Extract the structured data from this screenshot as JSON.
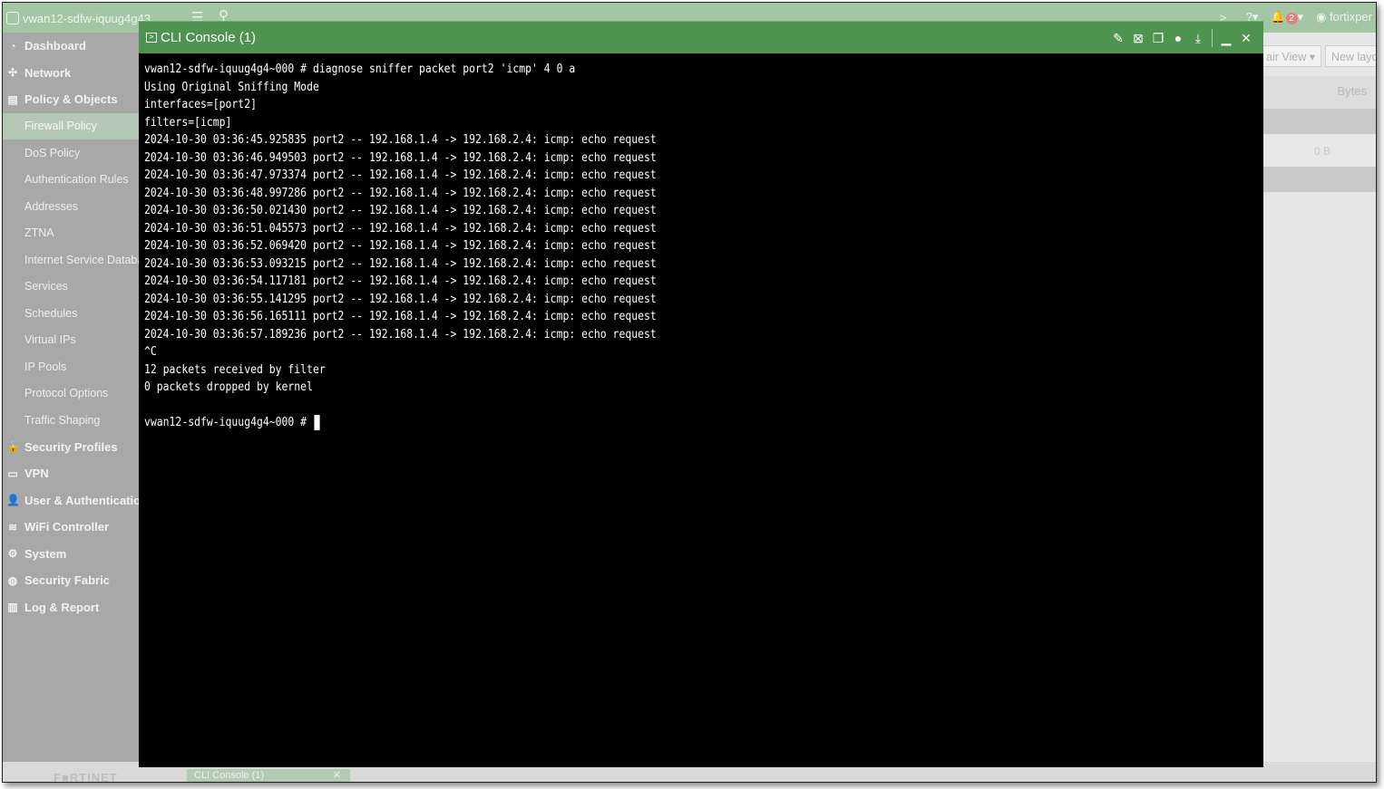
{
  "topbar": {
    "device_name": "vwan12-sdfw-iquug4g43...",
    "alert_count": "2",
    "user": "fortixper"
  },
  "sidebar": {
    "items": [
      {
        "label": "Dashboard",
        "icon": "dashboard-icon",
        "glyph": "◔",
        "type": "section"
      },
      {
        "label": "Network",
        "icon": "network-icon",
        "glyph": "✣",
        "type": "section"
      },
      {
        "label": "Policy & Objects",
        "icon": "policy-icon",
        "glyph": "▤",
        "type": "section open"
      },
      {
        "label": "Firewall Policy",
        "type": "sub active"
      },
      {
        "label": "DoS Policy",
        "type": "sub"
      },
      {
        "label": "Authentication Rules",
        "type": "sub"
      },
      {
        "label": "Addresses",
        "type": "sub"
      },
      {
        "label": "ZTNA",
        "type": "sub"
      },
      {
        "label": "Internet Service Database",
        "type": "sub"
      },
      {
        "label": "Services",
        "type": "sub"
      },
      {
        "label": "Schedules",
        "type": "sub"
      },
      {
        "label": "Virtual IPs",
        "type": "sub"
      },
      {
        "label": "IP Pools",
        "type": "sub"
      },
      {
        "label": "Protocol Options",
        "type": "sub"
      },
      {
        "label": "Traffic Shaping",
        "type": "sub"
      },
      {
        "label": "Security Profiles",
        "icon": "lock-icon",
        "glyph": "🔒",
        "type": "section"
      },
      {
        "label": "VPN",
        "icon": "vpn-icon",
        "glyph": "▭",
        "type": "section"
      },
      {
        "label": "User & Authentication",
        "icon": "user-icon",
        "glyph": "👤",
        "type": "section"
      },
      {
        "label": "WiFi Controller",
        "icon": "wifi-icon",
        "glyph": "≋",
        "type": "section"
      },
      {
        "label": "System",
        "icon": "gear-icon",
        "glyph": "⚙",
        "type": "section"
      },
      {
        "label": "Security Fabric",
        "icon": "fabric-icon",
        "glyph": "◍",
        "type": "section"
      },
      {
        "label": "Log & Report",
        "icon": "chart-icon",
        "glyph": "▥",
        "type": "section"
      }
    ]
  },
  "background": {
    "pair_view_label": "air View ▾",
    "new_layout_label": "New layo",
    "bytes_header": "Bytes",
    "bytes_value": "0 B"
  },
  "bottom": {
    "brand": "F■RTINET",
    "taskbar_tab": "CLI Console (1)"
  },
  "console": {
    "title": "CLI Console (1)",
    "lines": [
      "vwan12-sdfw-iquug4g4~000 # diagnose sniffer packet port2 'icmp' 4 0 a",
      "Using Original Sniffing Mode",
      "interfaces=[port2]",
      "filters=[icmp]",
      "2024-10-30 03:36:45.925835 port2 -- 192.168.1.4 -> 192.168.2.4: icmp: echo request",
      "2024-10-30 03:36:46.949503 port2 -- 192.168.1.4 -> 192.168.2.4: icmp: echo request",
      "2024-10-30 03:36:47.973374 port2 -- 192.168.1.4 -> 192.168.2.4: icmp: echo request",
      "2024-10-30 03:36:48.997286 port2 -- 192.168.1.4 -> 192.168.2.4: icmp: echo request",
      "2024-10-30 03:36:50.021430 port2 -- 192.168.1.4 -> 192.168.2.4: icmp: echo request",
      "2024-10-30 03:36:51.045573 port2 -- 192.168.1.4 -> 192.168.2.4: icmp: echo request",
      "2024-10-30 03:36:52.069420 port2 -- 192.168.1.4 -> 192.168.2.4: icmp: echo request",
      "2024-10-30 03:36:53.093215 port2 -- 192.168.1.4 -> 192.168.2.4: icmp: echo request",
      "2024-10-30 03:36:54.117181 port2 -- 192.168.1.4 -> 192.168.2.4: icmp: echo request",
      "2024-10-30 03:36:55.141295 port2 -- 192.168.1.4 -> 192.168.2.4: icmp: echo request",
      "2024-10-30 03:36:56.165111 port2 -- 192.168.1.4 -> 192.168.2.4: icmp: echo request",
      "2024-10-30 03:36:57.189236 port2 -- 192.168.1.4 -> 192.168.2.4: icmp: echo request",
      "^C",
      "12 packets received by filter",
      "0 packets dropped by kernel",
      ""
    ],
    "prompt": "vwan12-sdfw-iquug4g4~000 # "
  }
}
